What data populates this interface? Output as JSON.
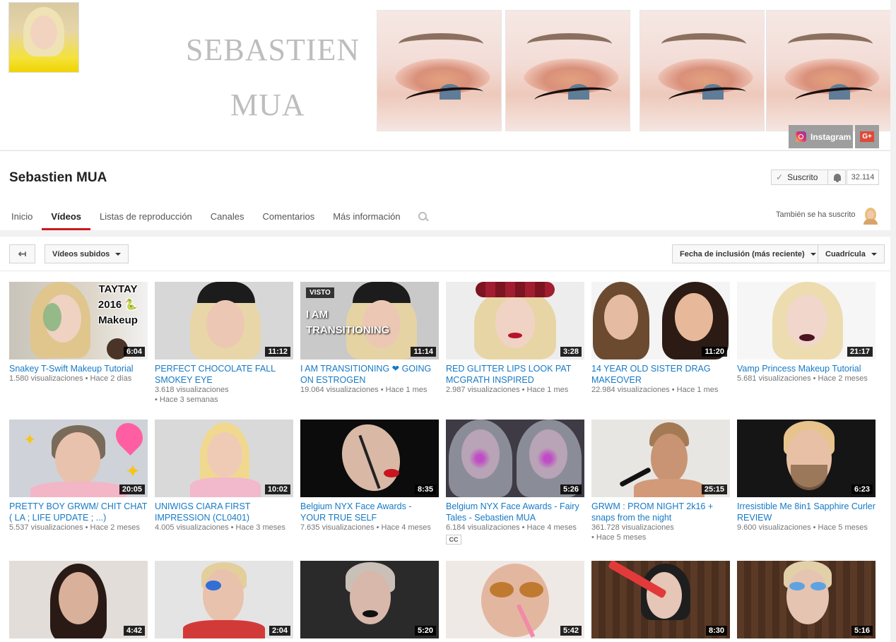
{
  "banner": {
    "title_line1": "SEBASTIEN",
    "title_line2": "MUA",
    "links": {
      "instagram": "Instagram",
      "gplus": "G+"
    }
  },
  "channel": {
    "name": "Sebastien MUA",
    "subscribe_label": "Suscrito",
    "subscriber_count": "32.114"
  },
  "tabs": [
    {
      "label": "Inicio",
      "active": false
    },
    {
      "label": "Vídeos",
      "active": true
    },
    {
      "label": "Listas de reproducción",
      "active": false
    },
    {
      "label": "Canales",
      "active": false
    },
    {
      "label": "Comentarios",
      "active": false
    },
    {
      "label": "Más información",
      "active": false
    }
  ],
  "also_subscribed_label": "También se ha suscrito",
  "toolbar": {
    "uploads_label": "Vídeos subidos",
    "sort_label": "Fecha de inclusión (más reciente)",
    "view_label": "Cuadrícula"
  },
  "colors": {
    "accent": "#cc181e",
    "link": "#167ac6",
    "meta": "#767676"
  },
  "videos": [
    {
      "title": "Snakey T-Swift Makeup Tutorial",
      "views": "1.580 visualizaciones",
      "age": "Hace 2 días",
      "duration": "6:04",
      "overlay": "TAYTAY 2016 🐍 Makeup"
    },
    {
      "title": "PERFECT CHOCOLATE FALL SMOKEY EYE",
      "views": "3.618 visualizaciones",
      "age": "Hace 3 semanas",
      "duration": "11:12"
    },
    {
      "title": "I AM TRANSITIONING ❤ GOING ON ESTROGEN",
      "views": "19.064 visualizaciones",
      "age": "Hace 1 mes",
      "duration": "11:14",
      "badge": "VISTO",
      "overlay": "I AM TRANSITIONING"
    },
    {
      "title": "RED GLITTER LIPS LOOK PAT MCGRATH INSPIRED",
      "views": "2.987 visualizaciones",
      "age": "Hace 1 mes",
      "duration": "3:28"
    },
    {
      "title": "14 YEAR OLD SISTER DRAG MAKEOVER",
      "views": "22.984 visualizaciones",
      "age": "Hace 1 mes",
      "duration": "11:20"
    },
    {
      "title": "Vamp Princess Makeup Tutorial",
      "views": "5.681 visualizaciones",
      "age": "Hace 2 meses",
      "duration": "21:17"
    },
    {
      "title": "PRETTY BOY GRWM/ CHIT CHAT ( LA ; LIFE UPDATE ; ...)",
      "views": "5.537 visualizaciones",
      "age": "Hace 2 meses",
      "duration": "20:05"
    },
    {
      "title": "UNIWIGS CIARA FIRST IMPRESSION (CL0401)",
      "views": "4.005 visualizaciones",
      "age": "Hace 3 meses",
      "duration": "10:02"
    },
    {
      "title": "Belgium NYX Face Awards - YOUR TRUE SELF",
      "views": "7.635 visualizaciones",
      "age": "Hace 4 meses",
      "duration": "8:35"
    },
    {
      "title": "Belgium NYX Face Awards - Fairy Tales - Sebastien MUA",
      "views": "6.184 visualizaciones",
      "age": "Hace 4 meses",
      "duration": "5:26",
      "cc": "CC"
    },
    {
      "title": "GRWM : PROM NIGHT 2k16 + snaps from the night",
      "views": "361.728 visualizaciones",
      "age": "Hace 5 meses",
      "duration": "25:15"
    },
    {
      "title": "Irresistible Me 8in1 Sapphire Curler REVIEW",
      "views": "9.600 visualizaciones",
      "age": "Hace 5 meses",
      "duration": "6:23"
    },
    {
      "duration": "4:42"
    },
    {
      "duration": "2:04"
    },
    {
      "duration": "5:20"
    },
    {
      "duration": "5:42"
    },
    {
      "duration": "8:30"
    },
    {
      "duration": "5:16"
    }
  ]
}
